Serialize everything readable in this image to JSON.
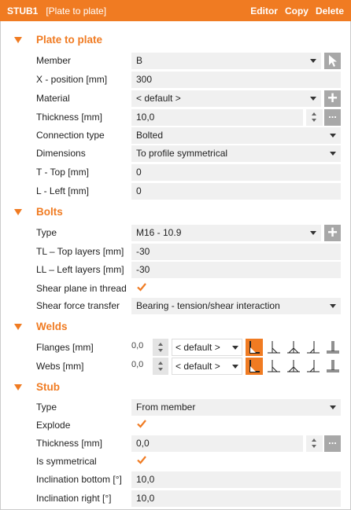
{
  "header": {
    "title": "STUB1",
    "subtitle": "[Plate to plate]",
    "actions": [
      "Editor",
      "Copy",
      "Delete"
    ]
  },
  "sections": {
    "plate": "Plate to plate",
    "bolts": "Bolts",
    "welds": "Welds",
    "stub": "Stub"
  },
  "plate": {
    "member_label": "Member",
    "member_value": "B",
    "xpos_label": "X - position [mm]",
    "xpos_value": "300",
    "material_label": "Material",
    "material_value": "< default >",
    "thickness_label": "Thickness [mm]",
    "thickness_value": "10,0",
    "conn_label": "Connection type",
    "conn_value": "Bolted",
    "dim_label": "Dimensions",
    "dim_value": "To profile symmetrical",
    "top_label": "T - Top [mm]",
    "top_value": "0",
    "left_label": "L - Left [mm]",
    "left_value": "0"
  },
  "bolts": {
    "type_label": "Type",
    "type_value": "M16 - 10.9",
    "tl_label": "TL – Top layers [mm]",
    "tl_value": "-30",
    "ll_label": "LL – Left layers [mm]",
    "ll_value": "-30",
    "shear_label": "Shear plane in thread",
    "shear_checked": true,
    "transfer_label": "Shear force transfer",
    "transfer_value": "Bearing - tension/shear interaction"
  },
  "welds": {
    "flanges_label": "Flanges [mm]",
    "flanges_value": "0,0",
    "flanges_material": "< default >",
    "webs_label": "Webs [mm]",
    "webs_value": "0,0",
    "webs_material": "< default >"
  },
  "stub": {
    "type_label": "Type",
    "type_value": "From member",
    "explode_label": "Explode",
    "explode_checked": true,
    "thickness_label": "Thickness [mm]",
    "thickness_value": "0,0",
    "sym_label": "Is symmetrical",
    "sym_checked": true,
    "incl_bottom_label": "Inclination bottom [°]",
    "incl_bottom_value": "10,0",
    "incl_right_label": "Inclination right [°]",
    "incl_right_value": "10,0"
  },
  "icons": {
    "select_member": "cursor-icon",
    "add": "plus-icon",
    "more": "ellipsis-icon",
    "check": "checkmark-icon",
    "weld_types": [
      "fillet-weld-icon",
      "single-bevel-weld-icon",
      "double-fillet-weld-icon",
      "one-side-fillet-weld-icon",
      "butt-weld-icon"
    ]
  },
  "colors": {
    "accent": "#f07b22",
    "field_bg": "#f0f0f0",
    "button_gray": "#a8a8a8"
  }
}
